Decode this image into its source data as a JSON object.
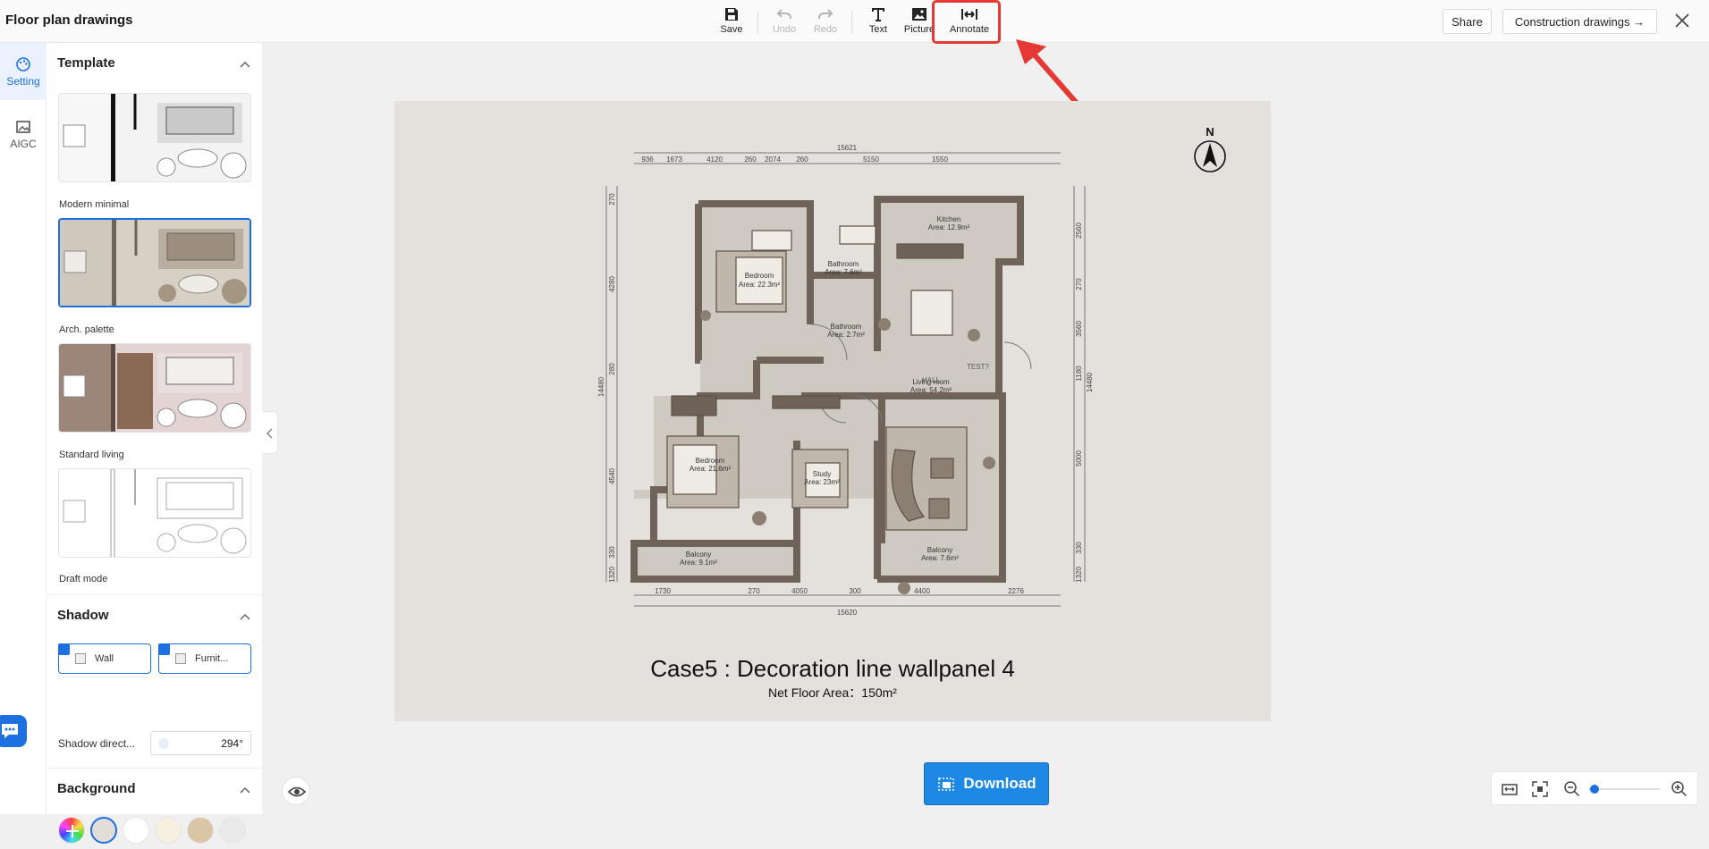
{
  "app": {
    "title": "Floor plan drawings"
  },
  "toolbar": {
    "save": "Save",
    "undo": "Undo",
    "redo": "Redo",
    "text": "Text",
    "picture": "Picture",
    "annotate": "Annotate"
  },
  "header": {
    "share": "Share",
    "construction": "Construction drawings →"
  },
  "rail": {
    "setting": "Setting",
    "aigc": "AIGC"
  },
  "template": {
    "heading": "Template",
    "items": [
      {
        "label": "Modern minimal",
        "selected": false
      },
      {
        "label": "Arch. palette",
        "selected": true
      },
      {
        "label": "Standard living",
        "selected": false
      },
      {
        "label": "Draft mode",
        "selected": false
      }
    ]
  },
  "shadow": {
    "heading": "Shadow",
    "wall": "Wall",
    "wall_checked": true,
    "furniture": "Furnit...",
    "furniture_checked": true,
    "direction_label": "Shadow direct...",
    "direction_value": "294°"
  },
  "background": {
    "heading": "Background",
    "swatches": [
      "#e2ddd6",
      "#ffffff",
      "#f6f0e1",
      "#d9c6a5",
      "#e9e9e9"
    ]
  },
  "plan": {
    "title": "Case5 : Decoration line wallpanel 4",
    "area": "Net Floor Area：150m²",
    "north": "N",
    "dims_top": [
      "15621",
      "936",
      "1673",
      "4120",
      "260",
      "2074",
      "260",
      "5150",
      "1550"
    ],
    "dims_bottom": [
      "1730",
      "270",
      "4050",
      "300",
      "4400",
      "2276",
      "15620"
    ],
    "dims_left": [
      "270",
      "4280",
      "280",
      "14480",
      "4540",
      "330",
      "1320"
    ],
    "dims_right": [
      "2560",
      "270",
      "3560",
      "1180",
      "14480",
      "5000",
      "330",
      "1320"
    ],
    "rooms": [
      {
        "name": "Bedroom",
        "area": "Area: 22.3m²"
      },
      {
        "name": "Bathroom",
        "area": "Area: 7.6m²"
      },
      {
        "name": "Kitchen",
        "area": "Area: 12.9m²"
      },
      {
        "name": "Bathroom",
        "area": "Area: 2.7m²"
      },
      {
        "name": "Living room",
        "area": "Area: 54.2m²"
      },
      {
        "name": "Bedroom",
        "area": "Area: 21.6m²"
      },
      {
        "name": "Study",
        "area": "Area: 23m²"
      },
      {
        "name": "Balcony",
        "area": "Area: 9.1m²"
      },
      {
        "name": "Balcony",
        "area": "Area: 7.6m²"
      }
    ],
    "labels": [
      "TEST?",
      "HALL"
    ]
  },
  "actions": {
    "download": "Download"
  },
  "colors": {
    "accent": "#1e6fe0",
    "download": "#1e88e5",
    "highlight": "#e53935",
    "wall": "#6e6259",
    "floor": "#cfcac1"
  }
}
